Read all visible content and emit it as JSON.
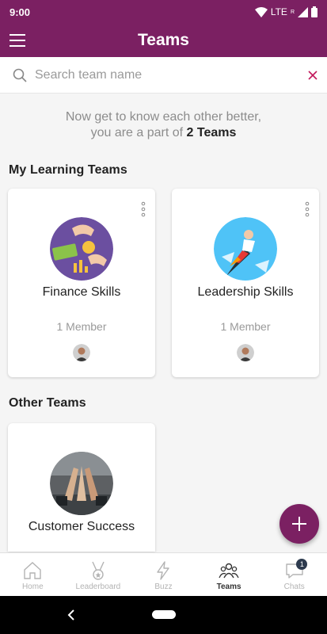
{
  "status_bar": {
    "time": "9:00",
    "network": "LTE",
    "network_sup": "R"
  },
  "header": {
    "title": "Teams"
  },
  "search": {
    "placeholder": "Search team name",
    "value": ""
  },
  "intro": {
    "line1": "Now get to know each other better,",
    "line2_prefix": "you are a part of ",
    "line2_bold": "2 Teams"
  },
  "sections": {
    "my_teams": {
      "title": "My Learning Teams",
      "cards": [
        {
          "name": "Finance Skills",
          "members": "1 Member",
          "image": "finance-illustration"
        },
        {
          "name": "Leadership Skills",
          "members": "1 Member",
          "image": "leadership-illustration"
        }
      ]
    },
    "other_teams": {
      "title": "Other Teams",
      "cards": [
        {
          "name": "Customer Success",
          "image": "team-high-five-photo"
        }
      ]
    }
  },
  "bottom_nav": {
    "items": [
      {
        "label": "Home",
        "icon": "home-icon"
      },
      {
        "label": "Leaderboard",
        "icon": "medal-icon"
      },
      {
        "label": "Buzz",
        "icon": "lightning-icon"
      },
      {
        "label": "Teams",
        "icon": "people-icon",
        "active": true
      },
      {
        "label": "Chats",
        "icon": "chat-icon",
        "badge": "1"
      }
    ]
  },
  "colors": {
    "brand": "#7b2062",
    "badge": "#2d3a4e"
  }
}
